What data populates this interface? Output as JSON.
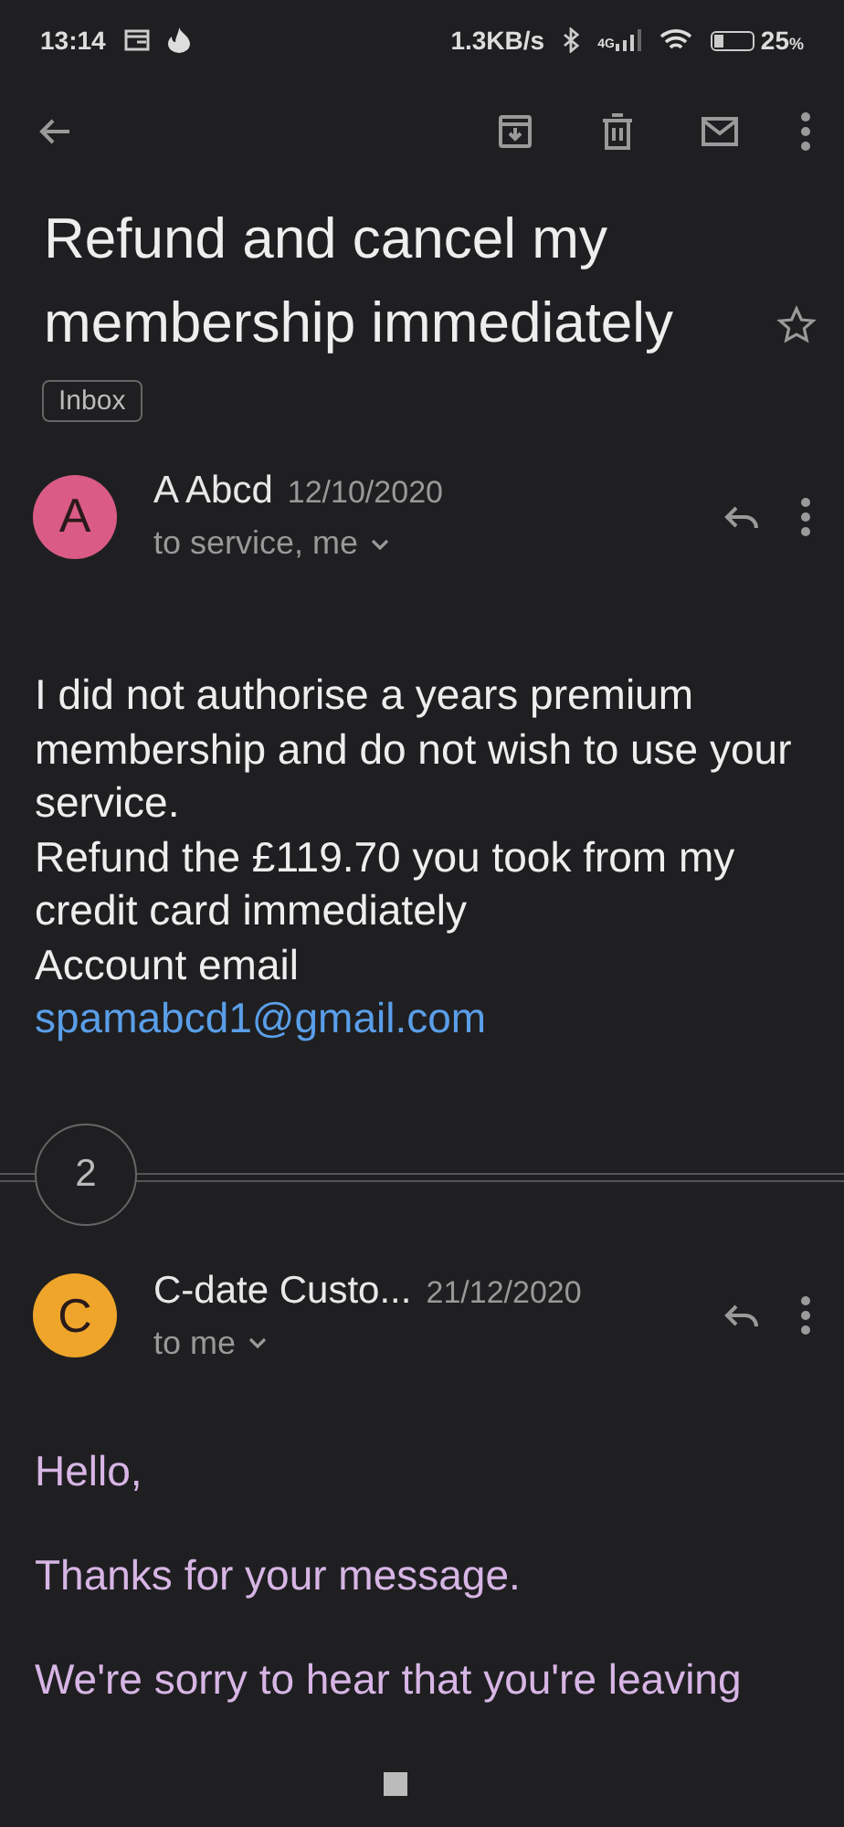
{
  "status_bar": {
    "time": "13:14",
    "speed": "1.3KB/s",
    "network": "4G",
    "battery": "25",
    "battery_unit": "%"
  },
  "subject": "Refund and cancel my membership immediately",
  "starred": false,
  "label": "Inbox",
  "messages": [
    {
      "avatar_letter": "A",
      "color": "#d95b86",
      "sender": "A Abcd",
      "date": "12/10/2020",
      "recipients": "to service, me",
      "body": [
        "I did not authorise a years premium membership and do not wish to use your service.",
        "Refund the £119.70 you took from my credit card immediately",
        "Account email"
      ],
      "link": "spamabcd1@gmail.com"
    }
  ],
  "collapsed_count": "2",
  "last_message": {
    "avatar_letter": "C",
    "color": "#eea52a",
    "sender": "C-date Custo...",
    "date": "21/12/2020",
    "recipients": "to me",
    "paragraphs": [
      "Hello,",
      "Thanks for your message.",
      "We're sorry to hear that you're leaving"
    ]
  }
}
